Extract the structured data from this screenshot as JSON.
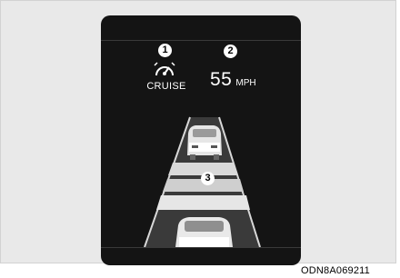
{
  "labels": {
    "marker_1": "1",
    "marker_2": "2",
    "marker_3": "3",
    "cruise": "CRUISE",
    "speed_value": "55",
    "speed_unit": "MPH"
  },
  "icons": {
    "cruise": "cruise-control-speedometer-icon",
    "lead_vehicle": "vehicle-rear-icon",
    "own_vehicle": "vehicle-front-icon"
  },
  "caption": "ODN8A069211"
}
